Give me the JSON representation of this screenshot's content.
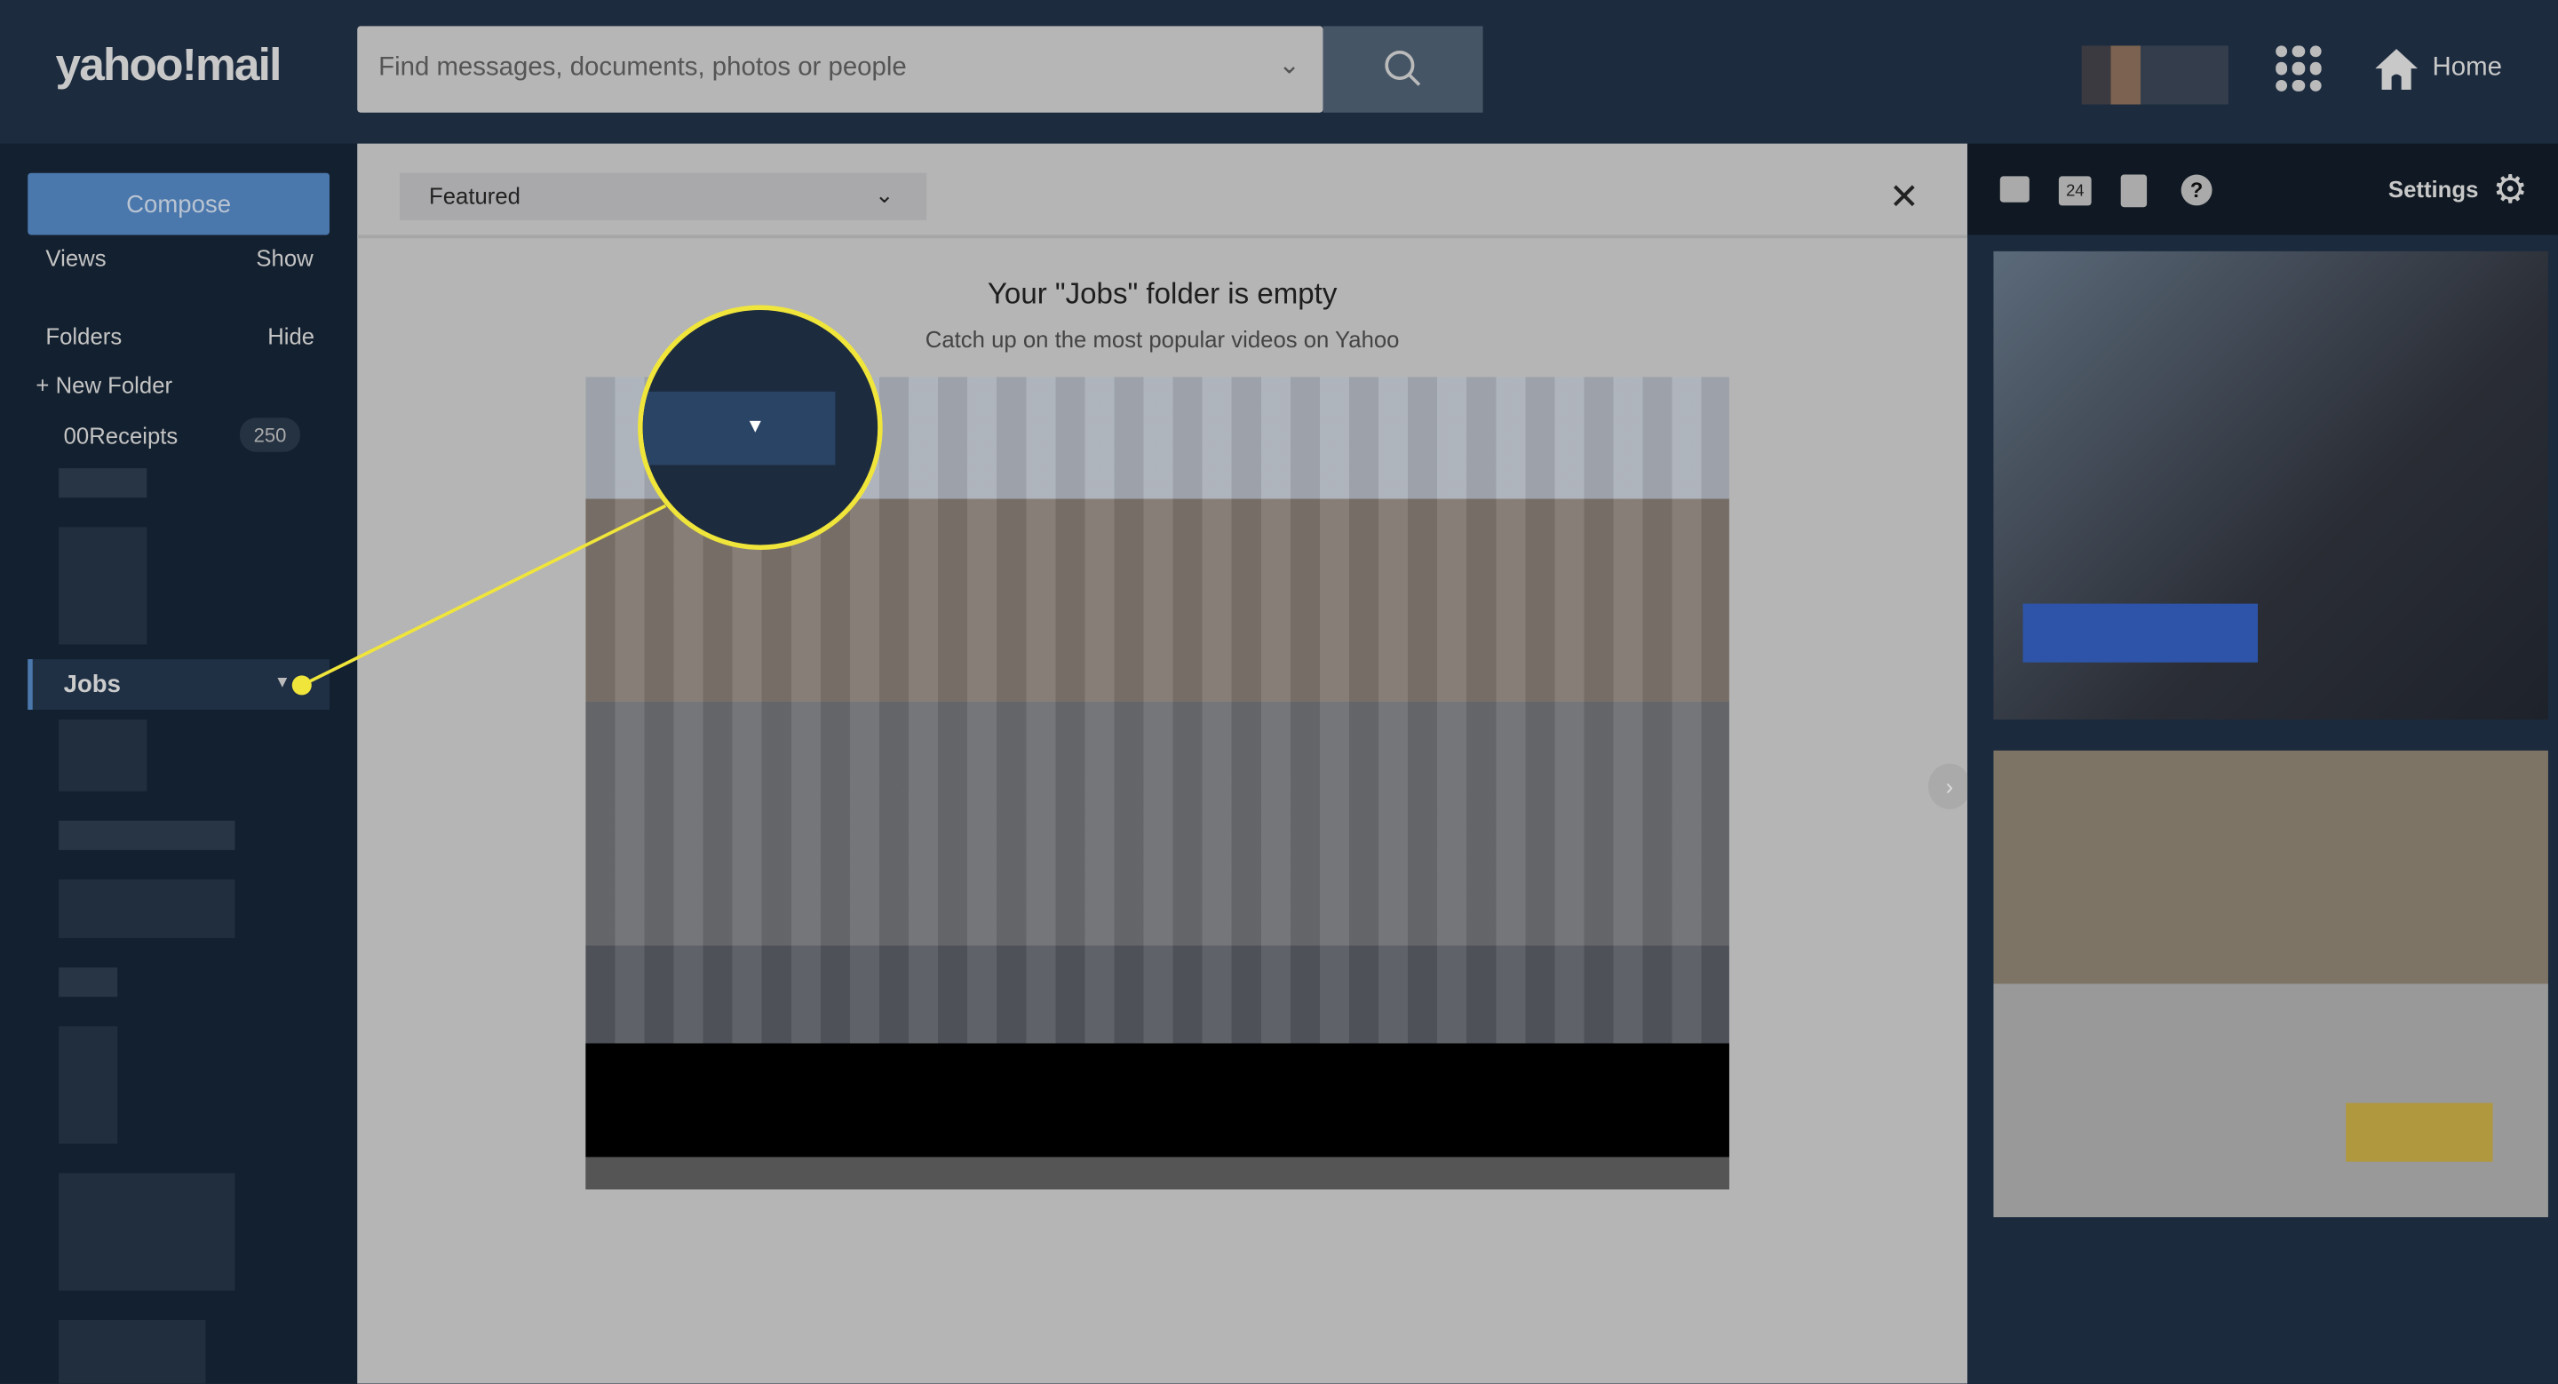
{
  "header": {
    "logo": "yahoo!mail",
    "search_placeholder": "Find messages, documents, photos or people",
    "home_label": "Home"
  },
  "sidebar": {
    "compose": "Compose",
    "views": "Views",
    "views_action": "Show",
    "folders": "Folders",
    "folders_action": "Hide",
    "new_folder": "New Folder",
    "folder_items": [
      {
        "label": "00Receipts",
        "count": "250"
      },
      {
        "label": "Jobs"
      }
    ]
  },
  "main": {
    "sort_label": "Featured",
    "empty_title": "Your \"Jobs\" folder is empty",
    "empty_subtitle": "Catch up on the most popular videos on Yahoo"
  },
  "right_panel": {
    "settings_label": "Settings",
    "calendar_day": "24"
  },
  "colors": {
    "accent": "#4a77ac",
    "callout": "#f0e53a"
  }
}
